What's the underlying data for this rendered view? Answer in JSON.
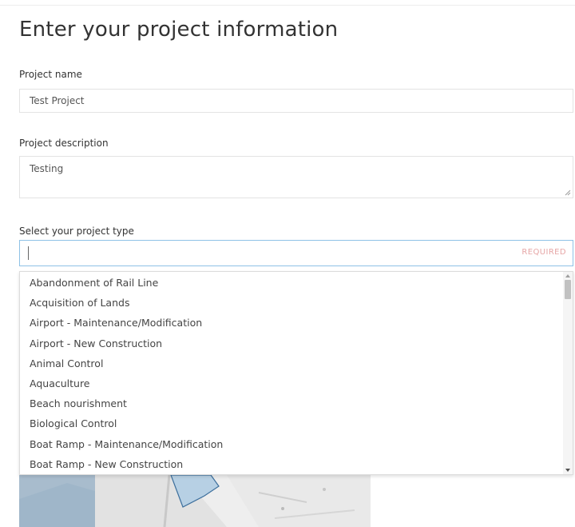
{
  "page": {
    "title": "Enter your project information"
  },
  "form": {
    "name_label": "Project name",
    "name_value": "Test Project",
    "description_label": "Project description",
    "description_value": "Testing",
    "type_label": "Select your project type",
    "type_value": "",
    "required_text": "REQUIRED"
  },
  "dropdown": {
    "options": [
      "Abandonment of Rail Line",
      "Acquisition of Lands",
      "Airport - Maintenance/Modification",
      "Airport - New Construction",
      "Animal Control",
      "Aquaculture",
      "Beach nourishment",
      "Biological Control",
      "Boat Ramp - Maintenance/Modification",
      "Boat Ramp - New Construction"
    ],
    "scroll_position": 0.0
  },
  "colors": {
    "focus_border": "#8ec2e6",
    "required": "#e6a6a6",
    "map_water": "#9fb6c9"
  },
  "icons": [
    "resize-grip-icon",
    "scroll-up-icon",
    "scroll-down-icon"
  ]
}
